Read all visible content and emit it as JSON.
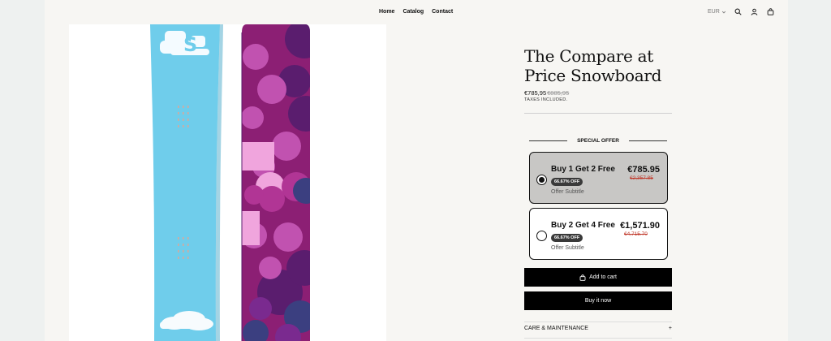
{
  "nav": {
    "home": "Home",
    "catalog": "Catalog",
    "contact": "Contact"
  },
  "header": {
    "currency": "EUR",
    "icons": [
      "search-icon",
      "account-icon",
      "cart-icon"
    ]
  },
  "product": {
    "title": "The Compare at Price Snowboard",
    "price": "€785,95",
    "compare_price": "€885,95",
    "taxes_note": "TAXES INCLUDED."
  },
  "special_offer": {
    "heading": "SPECIAL OFFER",
    "offers": [
      {
        "title": "Buy 1 Get 2 Free",
        "badge": "66.67% OFF",
        "subtitle": "Offer Subtitle",
        "price": "€785.95",
        "compare_price": "€2,357.85",
        "selected": true
      },
      {
        "title": "Buy 2 Get 4 Free",
        "badge": "66.67% OFF",
        "subtitle": "Offer Subtitle",
        "price": "€1,571.90",
        "compare_price": "€4,715.70",
        "selected": false
      }
    ]
  },
  "buttons": {
    "add_to_cart": "Add to cart",
    "buy_now": "Buy it now"
  },
  "accordion": {
    "care": "CARE & MAINTENANCE"
  },
  "colors": {
    "board_blue": "#6fcdeb",
    "board_purple": "#8c1f74",
    "button": "#000000",
    "selected_offer_bg": "#c8c7c5"
  }
}
